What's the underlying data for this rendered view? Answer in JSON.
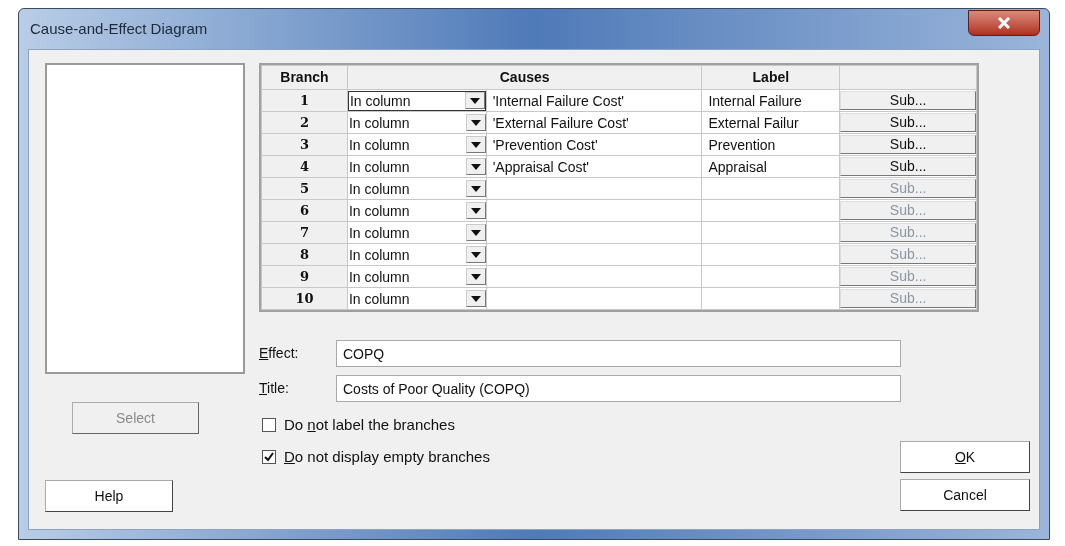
{
  "window": {
    "title": "Cause-and-Effect Diagram"
  },
  "table": {
    "columns": [
      "Branch",
      "Causes",
      "Label"
    ],
    "rows": [
      {
        "branch": "1",
        "method": "In column",
        "cause": "'Internal Failure Cost'",
        "label": "Internal Failure",
        "sub": {
          "text": "Sub...",
          "disabled": false
        }
      },
      {
        "branch": "2",
        "method": "In column",
        "cause": "'External Failure Cost'",
        "label": "External Failur",
        "sub": {
          "text": "Sub...",
          "disabled": false
        }
      },
      {
        "branch": "3",
        "method": "In column",
        "cause": "'Prevention Cost'",
        "label": "Prevention",
        "sub": {
          "text": "Sub...",
          "disabled": false
        }
      },
      {
        "branch": "4",
        "method": "In column",
        "cause": "'Appraisal Cost'",
        "label": "Appraisal",
        "sub": {
          "text": "Sub...",
          "disabled": false
        }
      },
      {
        "branch": "5",
        "method": "In column",
        "sub": {
          "text": "Sub...",
          "disabled": true
        }
      },
      {
        "branch": "6",
        "method": "In column",
        "sub": {
          "text": "Sub...",
          "disabled": true
        }
      },
      {
        "branch": "7",
        "method": "In column",
        "sub": {
          "text": "Sub...",
          "disabled": true
        }
      },
      {
        "branch": "8",
        "method": "In column",
        "sub": {
          "text": "Sub...",
          "disabled": true
        }
      },
      {
        "branch": "9",
        "method": "In column",
        "sub": {
          "text": "Sub...",
          "disabled": true
        }
      },
      {
        "branch": "10",
        "method": "In column",
        "sub": {
          "text": "Sub...",
          "disabled": true
        }
      }
    ]
  },
  "fields": [
    {
      "label": {
        "key": "E",
        "after": "ffect:"
      },
      "value": "COPQ"
    },
    {
      "label": {
        "key": "T",
        "after": "itle:"
      },
      "value": "Costs of Poor Quality (COPQ)"
    }
  ],
  "checkboxes": [
    {
      "label": {
        "before": "Do ",
        "key": "n",
        "after": "ot label the branches"
      },
      "checked": false
    },
    {
      "label": {
        "key": "D",
        "after": "o not display empty branches"
      },
      "checked": true
    }
  ],
  "select_button": {
    "text": "Select",
    "disabled": true
  },
  "buttons": [
    {
      "text": {
        "key": "O",
        "after": "K"
      }
    },
    {
      "text": {
        "after": "Cancel"
      }
    }
  ],
  "help_button": {
    "text": "Help"
  }
}
